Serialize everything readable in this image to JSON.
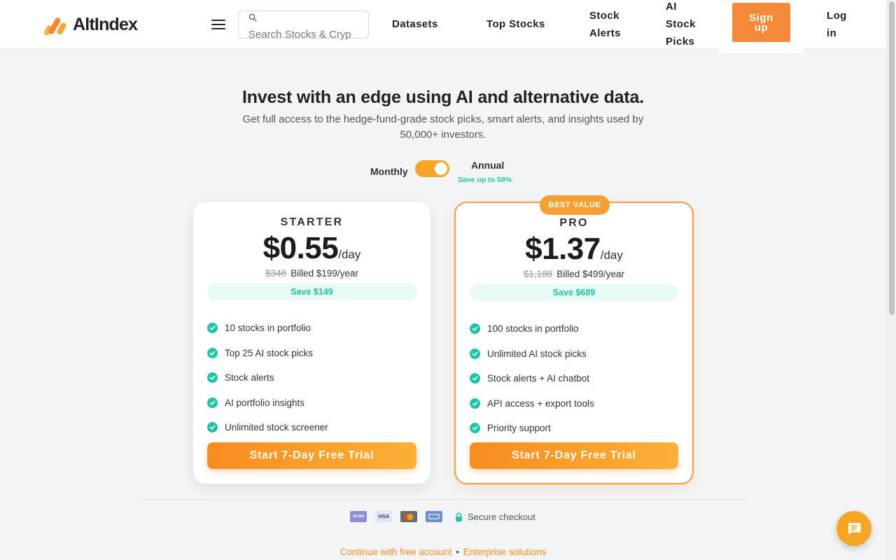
{
  "header": {
    "logo_text": "AltIndex",
    "search_placeholder": "Search Stocks & Cryp",
    "nav": {
      "datasets": "Datasets",
      "top_stocks": "Top Stocks",
      "stock_alerts_1": "Stock",
      "stock_alerts_2": "Alerts",
      "ai_picks_1": "AI",
      "ai_picks_2": "Stock",
      "ai_picks_3": "Picks",
      "signup_1": "Sign",
      "signup_2": "up",
      "login_1": "Log",
      "login_2": "in"
    }
  },
  "hero": {
    "title": "Invest with an edge using AI and alternative data.",
    "subtitle": "Get full access to the hedge-fund-grade stock picks, smart alerts, and insights used by 50,000+ investors."
  },
  "billing_toggle": {
    "monthly_label": "Monthly",
    "annual_label": "Annual",
    "annual_note": "Save up to 58%",
    "selected": "Annual"
  },
  "plans": {
    "starter": {
      "name": "STARTER",
      "price": "$0.55",
      "per": "/day",
      "original": "$348",
      "billed": "Billed $199/year",
      "save": "Save $149",
      "features": [
        "10 stocks in portfolio",
        "Top 25 AI stock picks",
        "Stock alerts",
        "AI portfolio insights",
        "Unlimited stock screener"
      ],
      "cta": "Start 7-Day Free Trial"
    },
    "pro": {
      "badge": "BEST VALUE",
      "name": "PRO",
      "price": "$1.37",
      "per": "/day",
      "original": "$1,188",
      "billed": "Billed $499/year",
      "save": "Save $689",
      "features": [
        "100 stocks in portfolio",
        "Unlimited AI stock picks",
        "Stock alerts + AI chatbot",
        "API access + export tools",
        "Priority support"
      ],
      "cta": "Start 7-Day Free Trial"
    }
  },
  "footer": {
    "payment_icons": [
      "stripe-icon",
      "visa-icon",
      "mastercard-icon",
      "amex-icon"
    ],
    "stripe_text": "stripe",
    "visa_text": "VISA",
    "secure_text": "Secure checkout",
    "free_link": "Continue with free account",
    "separator": "•",
    "enterprise_link": "Enterprise solutions"
  },
  "colors": {
    "accent": "#f5893a",
    "accent_light": "#fbb038",
    "success": "#1fc4a4",
    "background": "#f3f4f6"
  }
}
